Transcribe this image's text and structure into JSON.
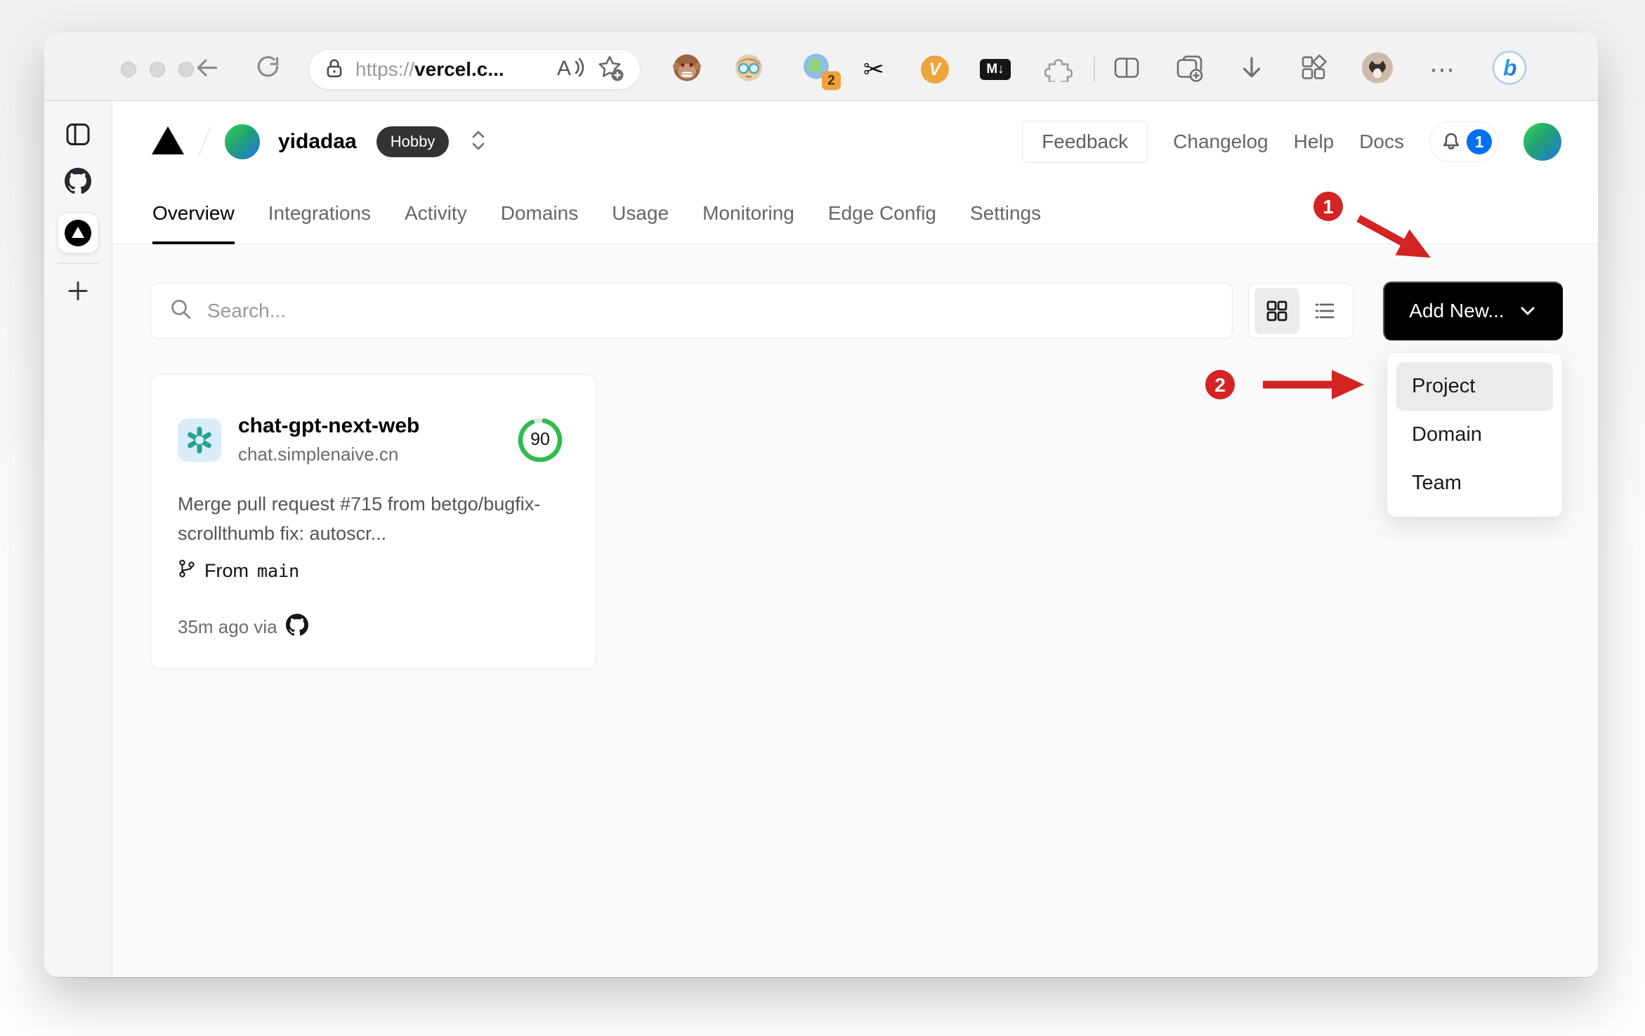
{
  "browser": {
    "url_scheme": "https://",
    "url_host": "vercel.c...",
    "extension_badge_count": "2",
    "markdown_ext_label": "M↓",
    "v_ext_label": "V",
    "scissors_glyph": "✂",
    "ellipsis_glyph": "⋯",
    "bing_label": "b"
  },
  "vercel": {
    "header": {
      "team_name": "yidadaa",
      "plan_badge": "Hobby",
      "feedback_label": "Feedback",
      "links": [
        {
          "label": "Changelog"
        },
        {
          "label": "Help"
        },
        {
          "label": "Docs"
        }
      ],
      "notification_count": "1"
    },
    "tabs": [
      {
        "label": "Overview"
      },
      {
        "label": "Integrations"
      },
      {
        "label": "Activity"
      },
      {
        "label": "Domains"
      },
      {
        "label": "Usage"
      },
      {
        "label": "Monitoring"
      },
      {
        "label": "Edge Config"
      },
      {
        "label": "Settings"
      }
    ],
    "toolbar": {
      "search_placeholder": "Search...",
      "add_new_label": "Add New..."
    },
    "dropdown": {
      "items": [
        {
          "label": "Project"
        },
        {
          "label": "Domain"
        },
        {
          "label": "Team"
        }
      ]
    },
    "card": {
      "title": "chat-gpt-next-web",
      "domain": "chat.simplenaive.cn",
      "score": "90",
      "commit_message": "Merge pull request #715 from betgo/bugfix-scrollthumb fix: autoscr...",
      "branch_prefix": "From",
      "branch_name": "main",
      "deployed_label": "35m ago via"
    }
  },
  "annotations": {
    "step1_label": "1",
    "step2_label": "2",
    "color": "#d32323"
  },
  "colors": {
    "accent_blue": "#0070f3",
    "gauge_green": "#2fbc4e",
    "openai_teal": "#27a389",
    "annotation_red": "#d32323",
    "add_new_black": "#000000"
  }
}
